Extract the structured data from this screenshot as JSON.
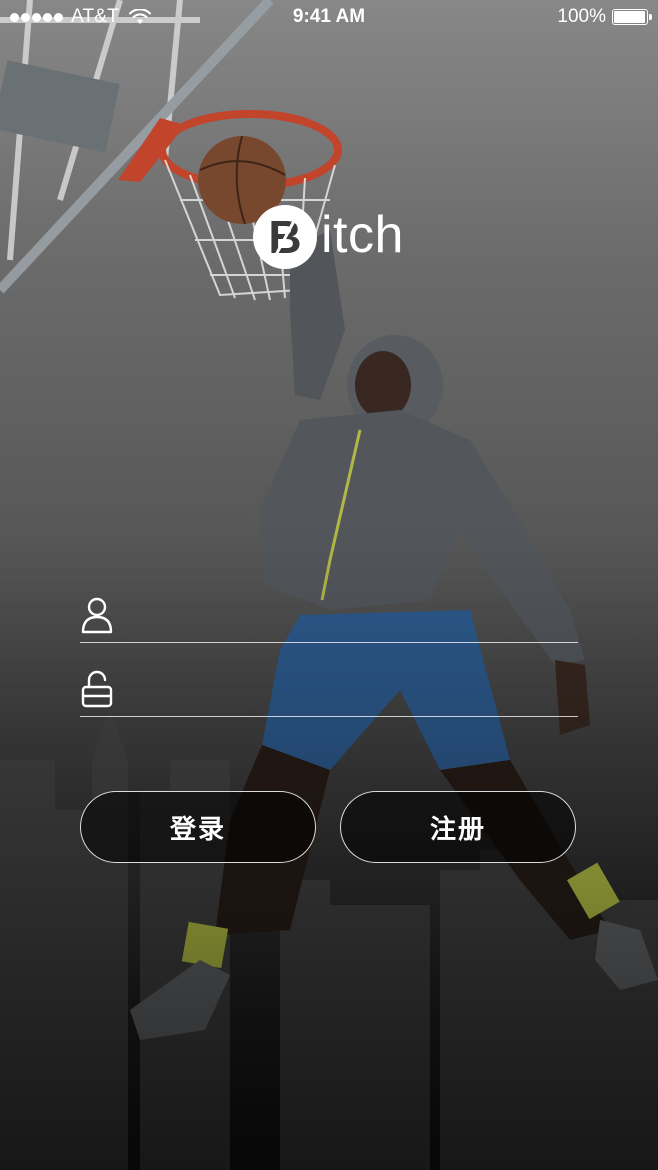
{
  "status_bar": {
    "carrier": "AT&T",
    "time": "9:41 AM",
    "battery": "100%",
    "battery_level": 1.0
  },
  "logo": {
    "badge_letter": "B",
    "text": "itch"
  },
  "form": {
    "username": {
      "icon": "user-icon",
      "value": "",
      "placeholder": ""
    },
    "password": {
      "icon": "unlock-icon",
      "value": "",
      "placeholder": ""
    }
  },
  "buttons": {
    "login_label": "登录",
    "register_label": "注册"
  },
  "colors": {
    "text": "#ffffff",
    "button_border": "#ffffff",
    "button_fill": "#111111"
  }
}
